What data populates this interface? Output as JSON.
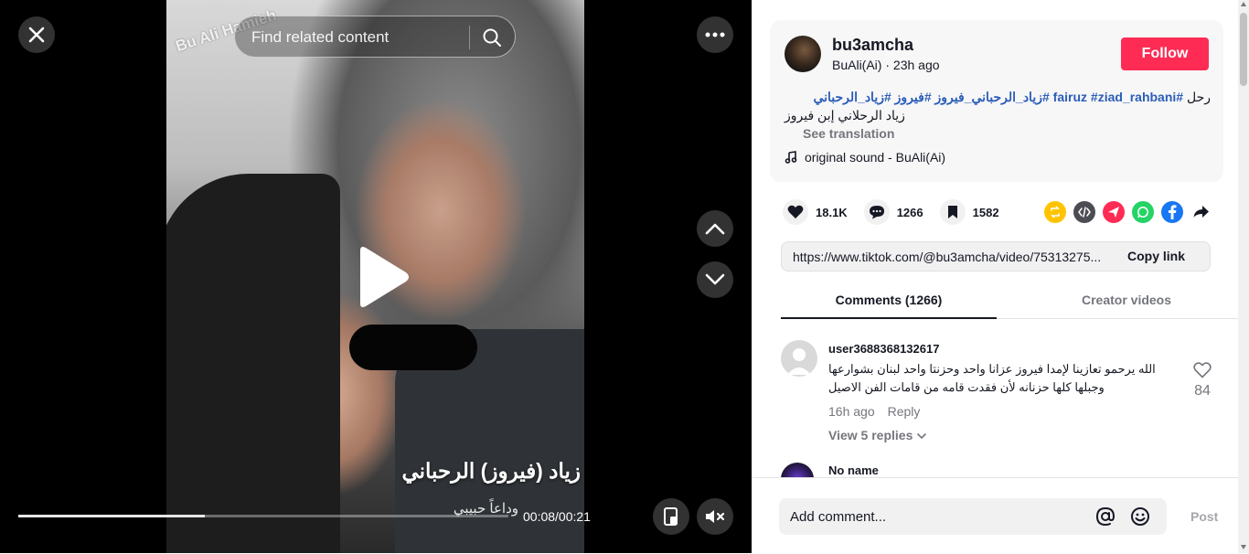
{
  "video": {
    "watermark": "Bu Ali Hamieh",
    "caption_main": "زياد (فيروز) الرحباني",
    "caption_sub": "وداعاً حبيبي",
    "time": "00:08/00:21",
    "progress": 0.38,
    "search_placeholder": "Find related content"
  },
  "post": {
    "username": "bu3amcha",
    "author": "BuAli(Ai)",
    "separator": " · ",
    "posted": "23h ago",
    "follow_label": "Follow",
    "desc_prefix": "رحل ",
    "hashtags": [
      "#fairuz",
      "#ziad_rahbani",
      "#زياد_الرحباني_فيروز",
      "#فيروز",
      "#زياد_الرحباني"
    ],
    "desc_line2": "زياد الرحلاني إبن فيروز",
    "see_translation": "See translation",
    "sound": "original sound - BuAli(Ai)"
  },
  "stats": {
    "likes": "18.1K",
    "comments": "1266",
    "saves": "1582"
  },
  "share": {
    "link": "https://www.tiktok.com/@bu3amcha/video/75313275...",
    "copy_label": "Copy link"
  },
  "tabs": {
    "comments": "Comments (1266)",
    "creator": "Creator videos"
  },
  "comments": [
    {
      "user": "user3688368132617",
      "text": "الله يرحمو تعازينا لإمدا فيروز عزانا واحد وحزنتا واحد لبنان بشوارعها وجبلها كلها حزنانه لأن فقدت قامه من قامات الفن الاصيل",
      "time": "16h ago",
      "reply_label": "Reply",
      "replies": "View 5 replies",
      "likes": "84"
    },
    {
      "user": "No name"
    }
  ],
  "comment_box": {
    "placeholder": "Add comment...",
    "post_label": "Post"
  },
  "colors": {
    "accent": "#fe2c55",
    "hashtag": "#2b5db9",
    "muted": "#75767d"
  }
}
